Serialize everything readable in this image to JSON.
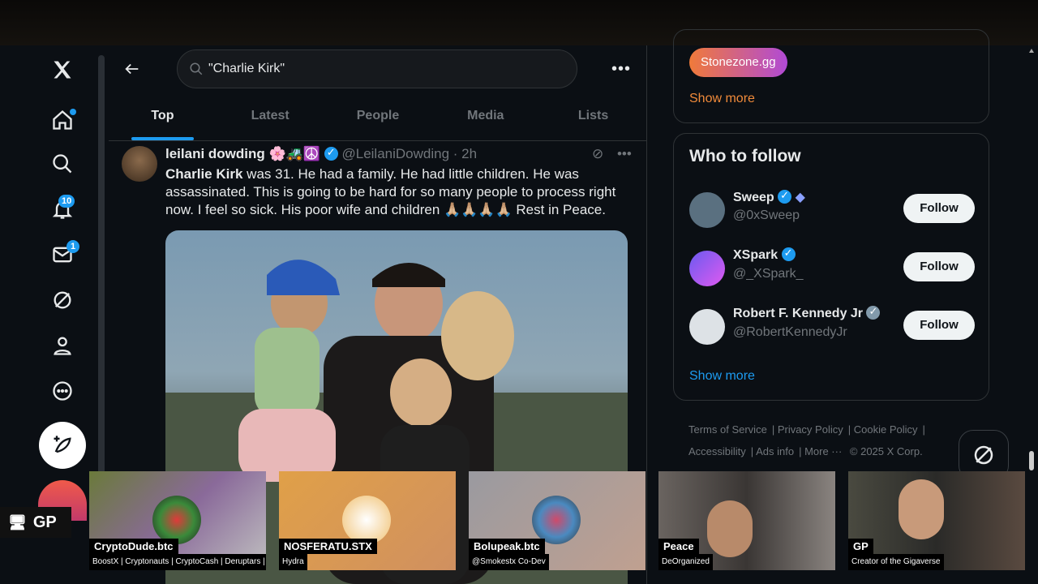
{
  "search": {
    "query": "\"Charlie Kirk\""
  },
  "nav": {
    "notifications_badge": "10",
    "messages_badge": "1"
  },
  "tabs": [
    "Top",
    "Latest",
    "People",
    "Media",
    "Lists"
  ],
  "active_tab": "Top",
  "tweet": {
    "name": "leilani dowding 🌸🚜☮️",
    "handle": "@LeilaniDowding",
    "time": "· 2h",
    "text_bold": "Charlie Kirk",
    "text": " was 31. He had a family. He had little children. He was assassinated.  This is going to be hard for so many people to process right now. I feel so sick.  His poor wife and children 🙏🏼🙏🏼🙏🏼🙏🏼 Rest in Peace."
  },
  "trends_card": {
    "chip": "Stonezone.gg",
    "show_more": "Show more"
  },
  "who_to_follow": {
    "title": "Who to follow",
    "items": [
      {
        "name": "Sweep",
        "handle": "@0xSweep",
        "button": "Follow"
      },
      {
        "name": "XSpark",
        "handle": "@_XSpark_",
        "button": "Follow"
      },
      {
        "name": "Robert F. Kennedy Jr",
        "handle": "@RobertKennedyJr",
        "button": "Follow"
      }
    ],
    "show_more": "Show more"
  },
  "footer": {
    "links": [
      "Terms of Service",
      "Privacy Policy",
      "Cookie Policy",
      "Accessibility",
      "Ads info",
      "More ···"
    ],
    "copyright": "© 2025 X Corp."
  },
  "stream": {
    "badge": "GP",
    "tiles": [
      {
        "label": "CryptoDude.btc",
        "sub": "BoostX | Cryptonauts | CryptoCash | Deruptars | Derupt"
      },
      {
        "label": "NOSFERATU.STX",
        "sub": "Hydra"
      },
      {
        "label": "Bolupeak.btc",
        "sub": "@Smokestx Co-Dev"
      },
      {
        "label": "Peace",
        "sub": "DeOrganized"
      },
      {
        "label": "GP",
        "sub": "Creator of the Gigaverse"
      }
    ]
  },
  "colors": {
    "accent": "#1d9bf0",
    "background": "#0b0f14"
  }
}
